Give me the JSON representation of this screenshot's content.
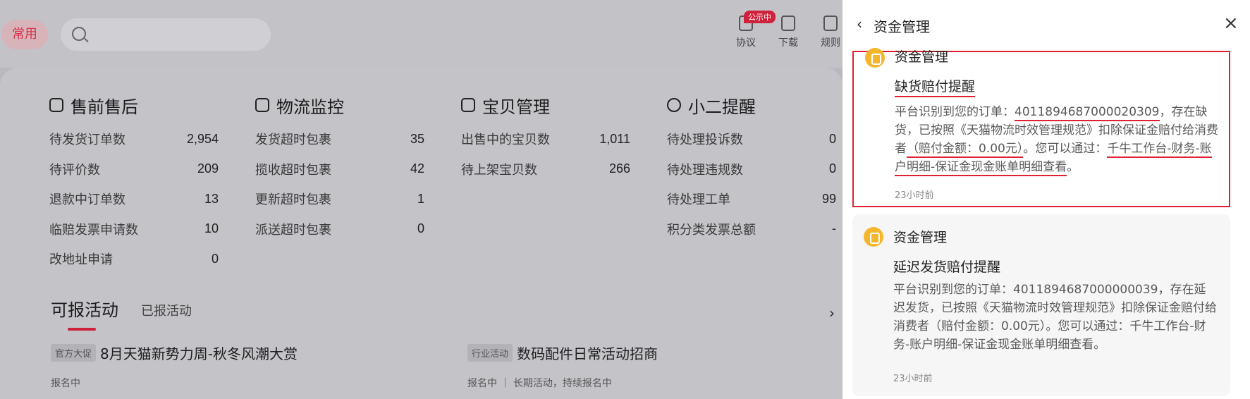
{
  "topbar": {
    "common_label": "常用",
    "tools": [
      {
        "label": "协议",
        "icon": "agreement-icon"
      },
      {
        "label": "下载",
        "icon": "download-icon"
      },
      {
        "label": "规则",
        "icon": "rules-icon"
      }
    ],
    "badge": "公示中"
  },
  "sections": [
    {
      "title": "售前售后",
      "icon": "order-icon",
      "rows": [
        {
          "label": "待发货订单数",
          "value": "2,954"
        },
        {
          "label": "待评价数",
          "value": "209"
        },
        {
          "label": "退款中订单数",
          "value": "13"
        },
        {
          "label": "临赔发票申请数",
          "value": "10"
        },
        {
          "label": "改地址申请",
          "value": "0"
        }
      ]
    },
    {
      "title": "物流监控",
      "icon": "truck-icon",
      "rows": [
        {
          "label": "发货超时包裹",
          "value": "35"
        },
        {
          "label": "揽收超时包裹",
          "value": "42"
        },
        {
          "label": "更新超时包裹",
          "value": "1"
        },
        {
          "label": "派送超时包裹",
          "value": "0"
        }
      ]
    },
    {
      "title": "宝贝管理",
      "icon": "store-icon",
      "rows": [
        {
          "label": "出售中的宝贝数",
          "value": "1,011"
        },
        {
          "label": "待上架宝贝数",
          "value": "266"
        }
      ]
    },
    {
      "title": "小二提醒",
      "icon": "stopwatch-icon",
      "rows": [
        {
          "label": "待处理投诉数",
          "value": "0"
        },
        {
          "label": "待处理违规数",
          "value": "0"
        },
        {
          "label": "待处理工单",
          "value": "99"
        },
        {
          "label": "积分类发票总额",
          "value": "-"
        }
      ]
    }
  ],
  "activities": {
    "tab_active": "可报活动",
    "tab_inactive": "已报活动",
    "items": [
      {
        "tag": "官方大促",
        "name": "8月天猫新势力周-秋冬风潮大赏",
        "status": "报名中"
      },
      {
        "tag": "行业活动",
        "name": "数码配件日常活动招商",
        "status": "报名中 ｜ 长期活动，持续报名中"
      }
    ]
  },
  "panel": {
    "title": "资金管理",
    "cards": [
      {
        "source": "资金管理",
        "heading": "缺货赔付提醒",
        "body_pre": "平台识别到您的订单：",
        "order_no": "4011894687000020309",
        "body_mid": "，存在缺货，已按照《天猫物流时效管理规范》扣除保证金赔付给消费者",
        "amount": "（赔付金额：0.00元）",
        "body_mid2": "。您可以通过：",
        "path": "千牛工作台-财务-账户明细-保证金现金账单明细查看",
        "body_end": "。",
        "time": "23小时前"
      },
      {
        "source": "资金管理",
        "heading": "延迟发货赔付提醒",
        "body": "平台识别到您的订单：4011894687000000039，存在延迟发货，已按照《天猫物流时效管理规范》扣除保证金赔付给消费者（赔付金额：0.00元）。您可以通过：千牛工作台-财务-账户明细-保证金现金账单明细查看。",
        "time": "23小时前"
      }
    ]
  }
}
